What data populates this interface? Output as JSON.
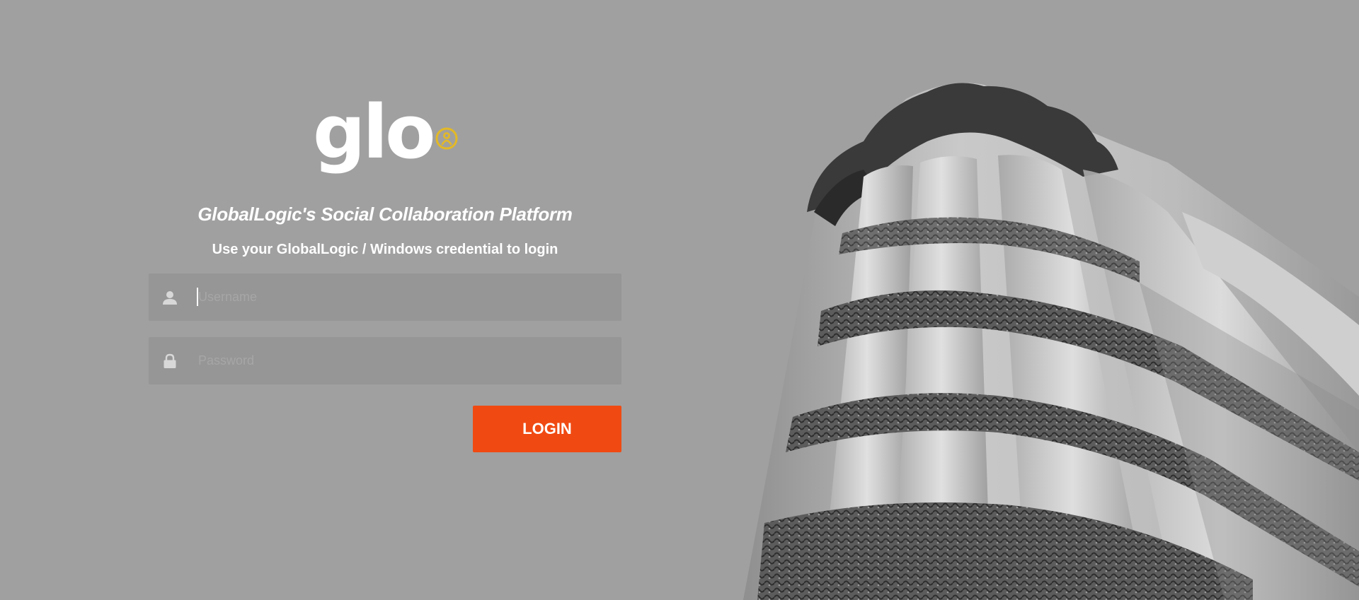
{
  "brand": {
    "logo_text": "glo",
    "badge_color": "#e3b927"
  },
  "header": {
    "tagline": "GlobalLogic's Social Collaboration Platform",
    "subtitle": "Use your GlobalLogic / Windows credential to login"
  },
  "form": {
    "username": {
      "value": "",
      "placeholder": "Username",
      "icon": "user-icon"
    },
    "password": {
      "value": "",
      "placeholder": "Password",
      "icon": "lock-icon"
    },
    "login_label": "LOGIN"
  },
  "colors": {
    "background": "#a0a0a0",
    "field_bg": "#969696",
    "accent": "#f04a12",
    "text": "#ffffff"
  }
}
